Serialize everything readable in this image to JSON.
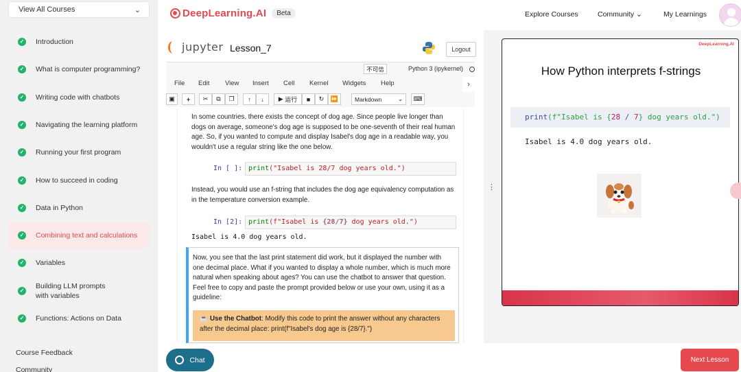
{
  "sidebar": {
    "course_select": "View All Courses",
    "lessons": [
      {
        "label": "Introduction"
      },
      {
        "label": "What is computer programming?"
      },
      {
        "label": "Writing code with chatbots"
      },
      {
        "label": "Navigating the learning platform"
      },
      {
        "label": "Running your first program"
      },
      {
        "label": "How to succeed in coding"
      },
      {
        "label": "Data in Python"
      },
      {
        "label": "Combining text and calculations"
      },
      {
        "label": "Variables"
      },
      {
        "label": "Building LLM prompts with variables"
      },
      {
        "label": "Functions: Actions on Data"
      }
    ],
    "footer_links": [
      "Course Feedback",
      "Community"
    ]
  },
  "topbar": {
    "logo_text": "DeepLearning.AI",
    "beta": "Beta",
    "nav": [
      "Explore Courses",
      "Community",
      "My Learnings"
    ],
    "community_chevron": "⌄"
  },
  "notebook": {
    "brand": "jupyter",
    "name": "Lesson_7",
    "logout": "Logout",
    "trust": "不可信",
    "kernel": "Python 3 (ipykernel)",
    "menu": [
      "File",
      "Edit",
      "View",
      "Insert",
      "Cell",
      "Kernel",
      "Widgets",
      "Help"
    ],
    "run_label": "运行",
    "cell_type": "Markdown",
    "paragraph1": "In some countries, there exists the concept of dog age. Since people live longer than dogs on average, someone's dog age is supposed to be one-seventh of their real human age. So, if you wanted to compute and display Isabel's dog age in a readable way, you wouldn't use a regular string like the one below.",
    "cell1_prompt": "In [ ]:",
    "cell1_fn": "print",
    "cell1_arg": "(\"Isabel is 28/7 dog years old.\")",
    "paragraph2": "Instead, you would use an f-string that includes the dog age equivalency computation as in the temperature conversion example.",
    "cell2_prompt": "In [2]:",
    "cell2_fn": "print",
    "cell2_open": "(f\"Isabel is ",
    "cell2_expr": "{28/7}",
    "cell2_close": " dog years old.\")",
    "cell2_output": "Isabel is 4.0 dog years old.",
    "paragraph3": "Now, you see that the last print statement did work, but it displayed the number with one decimal place. What if you wanted to display a whole number, which is much more natural when speaking about ages? You can use the chatbot to answer that question. Feel free to copy and paste the prompt provided below or use your own, using it as a guideline:",
    "chatbot_label": "Use the Chatbot",
    "chatbot_text": ": Modify this code to print the answer without any characters after the decimal place: print(f\"Isabel's dog age is {28/7}.\")"
  },
  "slide": {
    "brand": "DeepLearning.AI",
    "title": "How Python interprets f-strings",
    "code_fn": "print",
    "code_open": "(f\"Isabel is {",
    "code_a": "28",
    "code_op": " / ",
    "code_b": "7",
    "code_close": "} dog years old.\")",
    "output": "Isabel is 4.0 dog years old."
  },
  "bottombar": {
    "chat": "Chat",
    "next": "Next Lesson"
  },
  "colors": {
    "accent": "#e5484d",
    "check": "#1fb36b",
    "chat_button": "#1c6e8a"
  }
}
